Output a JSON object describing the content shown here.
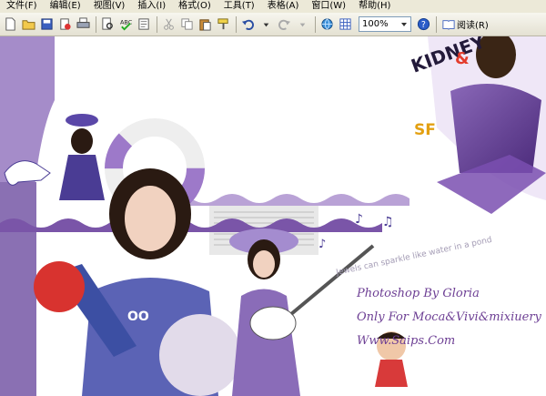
{
  "menubar": {
    "items": [
      "文件(F)",
      "编辑(E)",
      "视图(V)",
      "插入(I)",
      "格式(O)",
      "工具(T)",
      "表格(A)",
      "窗口(W)",
      "帮助(H)"
    ]
  },
  "toolbar": {
    "icons": [
      "new-icon",
      "open-icon",
      "save-icon",
      "permission-icon",
      "print-icon",
      "print-preview-icon",
      "spelling-icon",
      "research-icon",
      "cut-icon",
      "copy-icon",
      "paste-icon",
      "format-painter-icon",
      "undo-icon",
      "redo-icon",
      "hyperlink-icon",
      "tables-borders-icon",
      "help-icon",
      "read-icon"
    ],
    "zoom": "100%",
    "read_label": "阅读(R)"
  },
  "artwork": {
    "words": [
      "KIDNEY",
      "&",
      "SF"
    ],
    "tagline": "Jewels can sparkle like water in a pond",
    "credit_lines": [
      "Photoshop By Gloria",
      "Only For Moca&Vivi&mixiuery",
      "Www.Saips.Com"
    ],
    "colors": {
      "accent": "#7a4fb0",
      "dark_purple": "#4b2a7a",
      "lavender": "#b9a2d6"
    }
  }
}
